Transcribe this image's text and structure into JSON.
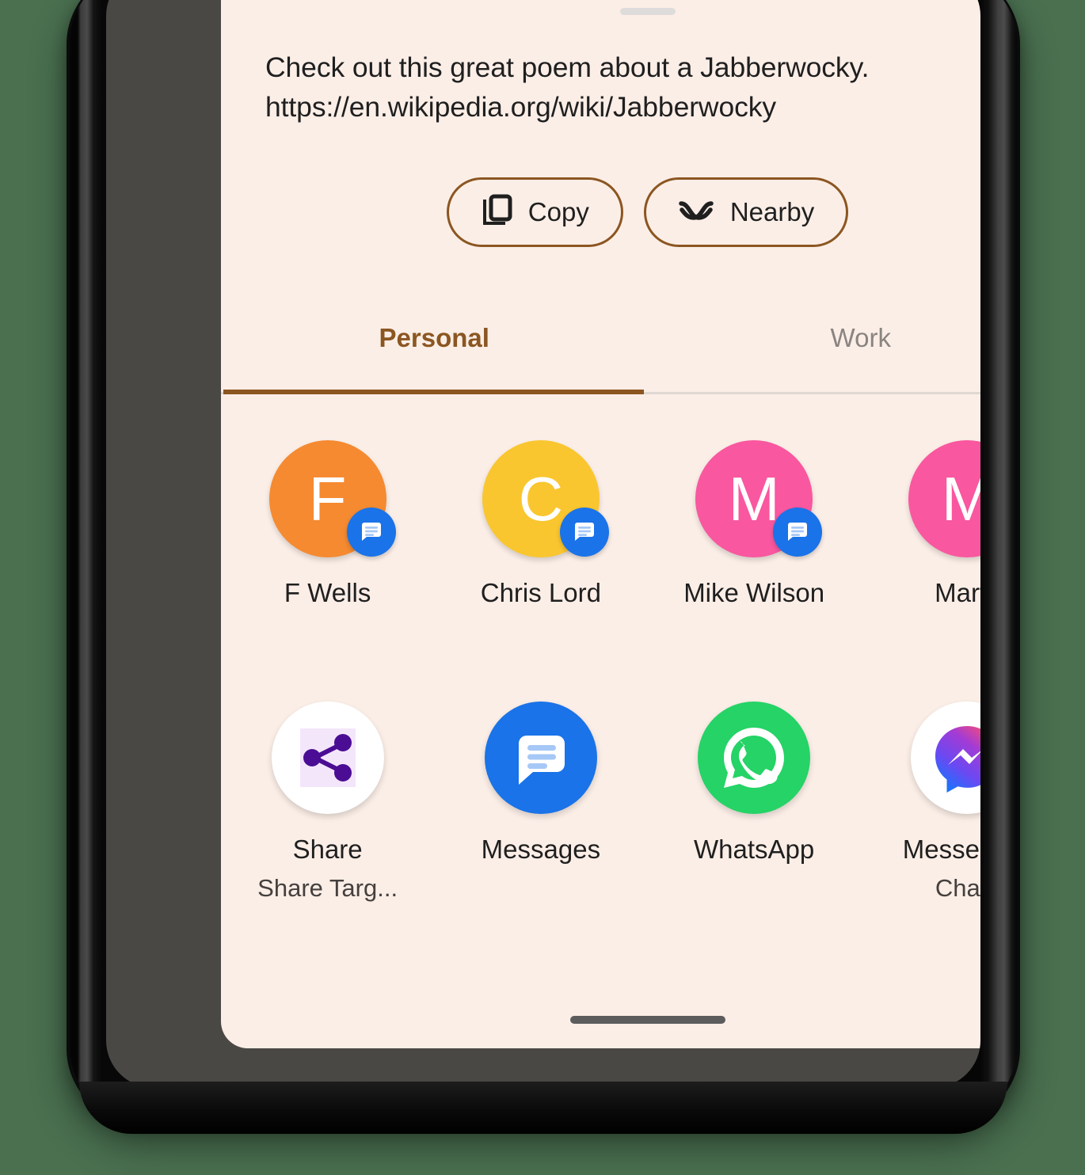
{
  "sheet": {
    "drag_handle": "drag-handle",
    "preview_text": "Check out this great poem about a Jabberwocky. https://en.wikipedia.org/wiki/Jabberwocky",
    "preview_line_1": "Check out this great poem about a Jabberwocky.",
    "preview_line_2": "https://en.wikipedia.org/wiki/Jabberwocky"
  },
  "actions": [
    {
      "label": "Copy",
      "icon": "copy-icon"
    },
    {
      "label": "Nearby",
      "icon": "nearby-share-icon"
    }
  ],
  "tabs": [
    {
      "label": "Personal",
      "active": true
    },
    {
      "label": "Work",
      "active": false
    }
  ],
  "contacts": [
    {
      "name": "F Wells",
      "initial": "F",
      "color": "#f58a31",
      "badge": "messages-icon"
    },
    {
      "name": "Chris Lord",
      "initial": "C",
      "color": "#fac62f",
      "badge": "messages-icon"
    },
    {
      "name": "Mike Wilson",
      "initial": "M",
      "color": "#f9579f",
      "badge": "messages-icon"
    },
    {
      "name": "Marty",
      "initial": "M",
      "color": "#f9579f",
      "badge": "messages-icon"
    }
  ],
  "apps": [
    {
      "label": "Share",
      "sublabel": "Share Targ...",
      "icon": "share-icon"
    },
    {
      "label": "Messages",
      "sublabel": "",
      "icon": "messages-icon"
    },
    {
      "label": "WhatsApp",
      "sublabel": "",
      "icon": "whatsapp-icon"
    },
    {
      "label": "Messenger",
      "sublabel": "Chats",
      "icon": "messenger-icon"
    }
  ],
  "colors": {
    "sheet_background": "#fbeee7",
    "accent_brown": "#8b5621",
    "page_background": "#4a7050",
    "messages_blue": "#1a73e8",
    "whatsapp_green": "#25d366",
    "inactive_tab": "#8a8481"
  },
  "home_indicator": "home-indicator"
}
